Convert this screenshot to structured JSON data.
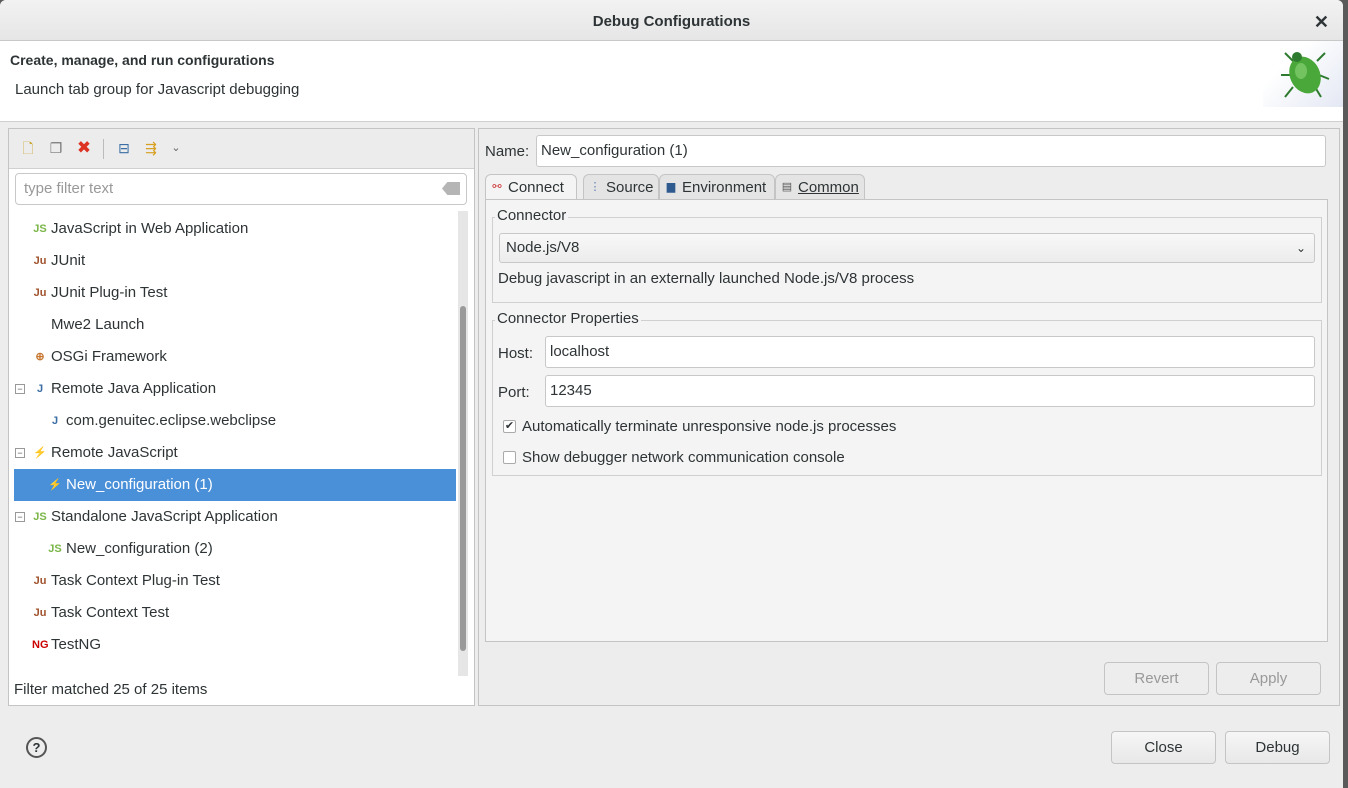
{
  "window": {
    "title": "Debug Configurations",
    "close_icon": "close-icon"
  },
  "header": {
    "title": "Create, manage, and run configurations",
    "subtitle": "Launch tab group for Javascript debugging"
  },
  "left": {
    "toolbar": [
      "new-config-icon",
      "duplicate-icon",
      "delete-icon",
      "collapse-all-icon",
      "filter-icon",
      "dropdown-chevron-icon"
    ],
    "filter_placeholder": "type filter text",
    "tree": [
      {
        "label": "JavaScript in Web Application",
        "icon": "JS",
        "level": 0
      },
      {
        "label": "JUnit",
        "icon": "Ju",
        "level": 0
      },
      {
        "label": "JUnit Plug-in Test",
        "icon": "Ju",
        "level": 0
      },
      {
        "label": "Mwe2 Launch",
        "icon": "",
        "level": 0
      },
      {
        "label": "OSGi Framework",
        "icon": "⊕",
        "level": 0
      },
      {
        "label": "Remote Java Application",
        "icon": "J",
        "level": 0,
        "expanded": true
      },
      {
        "label": "com.genuitec.eclipse.webclipse",
        "icon": "J",
        "level": 1
      },
      {
        "label": "Remote JavaScript",
        "icon": "⚡",
        "level": 0,
        "expanded": true
      },
      {
        "label": "New_configuration (1)",
        "icon": "⚡",
        "level": 1,
        "selected": true
      },
      {
        "label": "Standalone JavaScript Application",
        "icon": "JS",
        "level": 0,
        "expanded": true
      },
      {
        "label": "New_configuration (2)",
        "icon": "JS",
        "level": 1
      },
      {
        "label": "Task Context Plug-in Test",
        "icon": "Ju",
        "level": 0
      },
      {
        "label": "Task Context Test",
        "icon": "Ju",
        "level": 0
      },
      {
        "label": "TestNG",
        "icon": "NG",
        "level": 0
      }
    ],
    "status": "Filter matched 25 of 25 items"
  },
  "right": {
    "name_label": "Name:",
    "name_value": "New_configuration (1)",
    "tabs": [
      {
        "label": "Connect",
        "active": true
      },
      {
        "label": "Source"
      },
      {
        "label": "Environment"
      },
      {
        "label": "Common"
      }
    ],
    "connector": {
      "group_label": "Connector",
      "selected": "Node.js/V8",
      "description": "Debug javascript in an externally launched Node.js/V8 process"
    },
    "properties": {
      "group_label": "Connector Properties",
      "host_label": "Host:",
      "host": "localhost",
      "port_label": "Port:",
      "port": "12345",
      "auto_terminate_label": "Automatically terminate unresponsive node.js processes",
      "auto_terminate": true,
      "show_console_label": "Show debugger network communication console",
      "show_console": false
    },
    "revert": "Revert",
    "apply": "Apply"
  },
  "footer": {
    "help": "?",
    "close": "Close",
    "debug": "Debug"
  },
  "colors": {
    "selection": "#4a90d9"
  }
}
